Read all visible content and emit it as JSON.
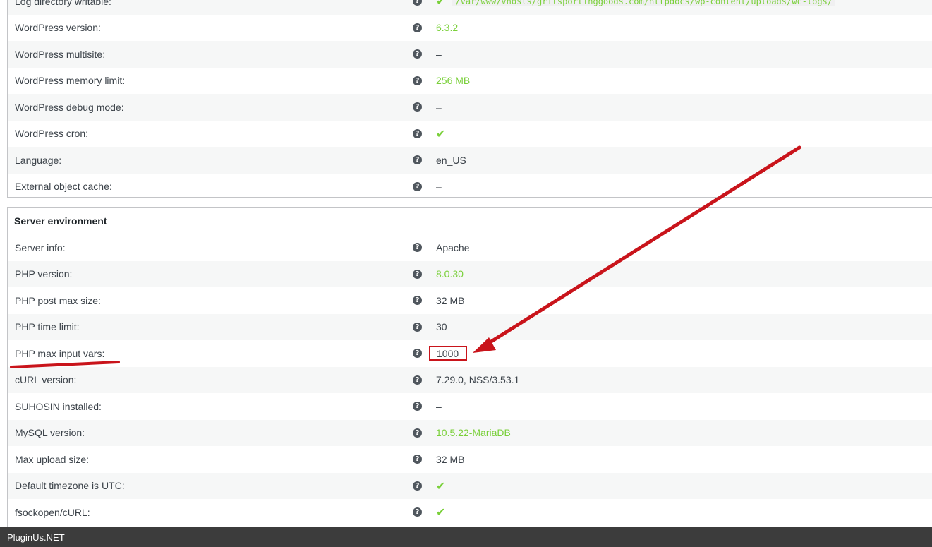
{
  "wordpress_environment": {
    "rows": [
      {
        "label": "Log directory writable:",
        "value": "/var/www/vhosts/gritsportinggoods.com/httpdocs/wp-content/uploads/wc-logs/",
        "type": "path"
      },
      {
        "label": "WordPress version:",
        "value": "6.3.2",
        "type": "ok"
      },
      {
        "label": "WordPress multisite:",
        "value": "–",
        "type": "plain"
      },
      {
        "label": "WordPress memory limit:",
        "value": "256 MB",
        "type": "ok"
      },
      {
        "label": "WordPress debug mode:",
        "value": "–",
        "type": "muted"
      },
      {
        "label": "WordPress cron:",
        "value": "✔",
        "type": "check"
      },
      {
        "label": "Language:",
        "value": "en_US",
        "type": "plain"
      },
      {
        "label": "External object cache:",
        "value": "–",
        "type": "muted"
      }
    ]
  },
  "server_environment": {
    "title": "Server environment",
    "rows": [
      {
        "label": "Server info:",
        "value": "Apache",
        "type": "plain"
      },
      {
        "label": "PHP version:",
        "value": "8.0.30",
        "type": "ok"
      },
      {
        "label": "PHP post max size:",
        "value": "32 MB",
        "type": "plain"
      },
      {
        "label": "PHP time limit:",
        "value": "30",
        "type": "plain"
      },
      {
        "label": "PHP max input vars:",
        "value": "1000",
        "type": "plain"
      },
      {
        "label": "cURL version:",
        "value": "7.29.0, NSS/3.53.1",
        "type": "plain"
      },
      {
        "label": "SUHOSIN installed:",
        "value": "–",
        "type": "plain"
      },
      {
        "label": "MySQL version:",
        "value": "10.5.22-MariaDB",
        "type": "ok"
      },
      {
        "label": "Max upload size:",
        "value": "32 MB",
        "type": "plain"
      },
      {
        "label": "Default timezone is UTC:",
        "value": "✔",
        "type": "check"
      },
      {
        "label": "fsockopen/cURL:",
        "value": "✔",
        "type": "check"
      }
    ]
  },
  "help_icon": "?",
  "annotation": {
    "color": "#c9141b",
    "highlighted_row": "PHP max input vars:"
  },
  "watermark": "PluginUs.NET"
}
